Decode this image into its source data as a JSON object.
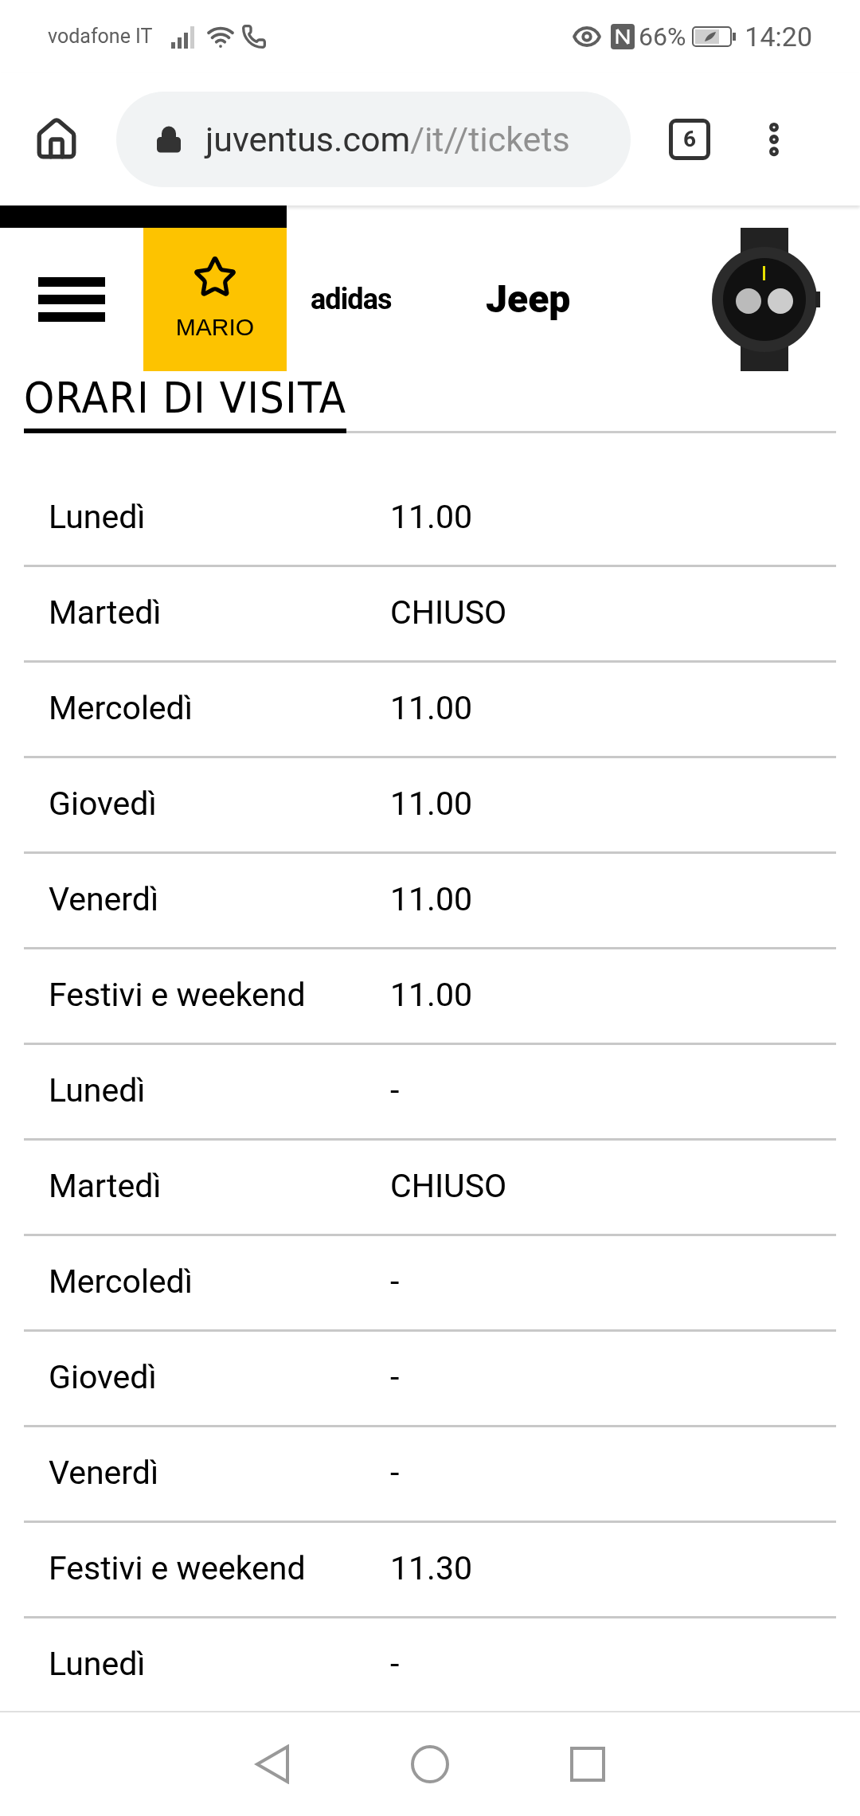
{
  "status_bar": {
    "carrier": "vodafone IT",
    "battery": "66%",
    "time": "14:20"
  },
  "browser": {
    "url_host": "juventus.com",
    "url_path": "/it//tickets",
    "tab_count": "6"
  },
  "header": {
    "account_label": "MARIO",
    "sponsors": [
      "adidas",
      "Jeep"
    ]
  },
  "section_title": "ORARI DI VISITA",
  "rows": [
    {
      "day": "Lunedì",
      "time": "11.00"
    },
    {
      "day": "Martedì",
      "time": "CHIUSO"
    },
    {
      "day": "Mercoledì",
      "time": "11.00"
    },
    {
      "day": "Giovedì",
      "time": "11.00"
    },
    {
      "day": "Venerdì",
      "time": "11.00"
    },
    {
      "day": "Festivi e weekend",
      "time": "11.00"
    },
    {
      "day": "Lunedì",
      "time": "-"
    },
    {
      "day": "Martedì",
      "time": "CHIUSO"
    },
    {
      "day": "Mercoledì",
      "time": "-"
    },
    {
      "day": "Giovedì",
      "time": "-"
    },
    {
      "day": "Venerdì",
      "time": "-"
    },
    {
      "day": "Festivi e weekend",
      "time": "11.30"
    },
    {
      "day": "Lunedì",
      "time": "-"
    }
  ]
}
